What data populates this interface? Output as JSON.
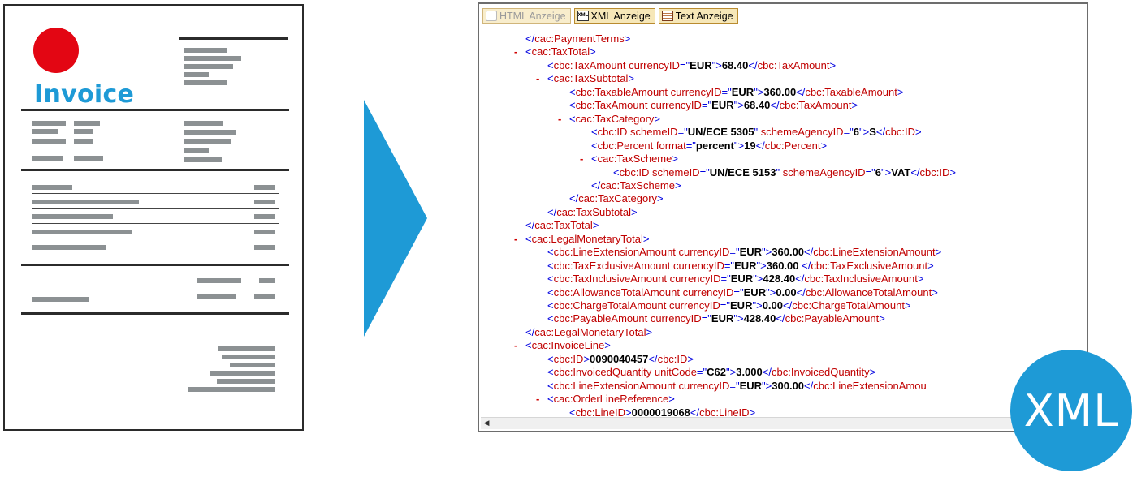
{
  "invoice": {
    "title": "Invoice"
  },
  "toolbar": {
    "html_label": "HTML Anzeige",
    "xml_label": "XML Anzeige",
    "text_label": "Text Anzeige",
    "xml_icon_text": "XML"
  },
  "xml_lines": [
    {
      "indent": 2,
      "marker": "",
      "parts": [
        [
          "b",
          "</"
        ],
        [
          "r",
          "cac:PaymentTerms"
        ],
        [
          "b",
          ">"
        ]
      ]
    },
    {
      "indent": 2,
      "marker": "-",
      "parts": [
        [
          "b",
          "<"
        ],
        [
          "r",
          "cac:TaxTotal"
        ],
        [
          "b",
          ">"
        ]
      ]
    },
    {
      "indent": 3,
      "marker": "",
      "parts": [
        [
          "b",
          "<"
        ],
        [
          "r",
          "cbc:TaxAmount currencyID"
        ],
        [
          "b",
          "=\""
        ],
        [
          "k",
          "EUR"
        ],
        [
          "b",
          "\">"
        ],
        [
          "k",
          "68.40"
        ],
        [
          "b",
          "</"
        ],
        [
          "r",
          "cbc:TaxAmount"
        ],
        [
          "b",
          ">"
        ]
      ]
    },
    {
      "indent": 3,
      "marker": "-",
      "parts": [
        [
          "b",
          "<"
        ],
        [
          "r",
          "cac:TaxSubtotal"
        ],
        [
          "b",
          ">"
        ]
      ]
    },
    {
      "indent": 4,
      "marker": "",
      "parts": [
        [
          "b",
          "<"
        ],
        [
          "r",
          "cbc:TaxableAmount currencyID"
        ],
        [
          "b",
          "=\""
        ],
        [
          "k",
          "EUR"
        ],
        [
          "b",
          "\">"
        ],
        [
          "k",
          "360.00"
        ],
        [
          "b",
          "</"
        ],
        [
          "r",
          "cbc:TaxableAmount"
        ],
        [
          "b",
          ">"
        ]
      ]
    },
    {
      "indent": 4,
      "marker": "",
      "parts": [
        [
          "b",
          "<"
        ],
        [
          "r",
          "cbc:TaxAmount currencyID"
        ],
        [
          "b",
          "=\""
        ],
        [
          "k",
          "EUR"
        ],
        [
          "b",
          "\">"
        ],
        [
          "k",
          "68.40"
        ],
        [
          "b",
          "</"
        ],
        [
          "r",
          "cbc:TaxAmount"
        ],
        [
          "b",
          ">"
        ]
      ]
    },
    {
      "indent": 4,
      "marker": "-",
      "parts": [
        [
          "b",
          "<"
        ],
        [
          "r",
          "cac:TaxCategory"
        ],
        [
          "b",
          ">"
        ]
      ]
    },
    {
      "indent": 5,
      "marker": "",
      "parts": [
        [
          "b",
          "<"
        ],
        [
          "r",
          "cbc:ID schemeID"
        ],
        [
          "b",
          "=\""
        ],
        [
          "k",
          "UN/ECE 5305"
        ],
        [
          "b",
          "\" "
        ],
        [
          "r",
          "schemeAgencyID"
        ],
        [
          "b",
          "=\""
        ],
        [
          "k",
          "6"
        ],
        [
          "b",
          "\">"
        ],
        [
          "k",
          "S"
        ],
        [
          "b",
          "</"
        ],
        [
          "r",
          "cbc:ID"
        ],
        [
          "b",
          ">"
        ]
      ]
    },
    {
      "indent": 5,
      "marker": "",
      "parts": [
        [
          "b",
          "<"
        ],
        [
          "r",
          "cbc:Percent format"
        ],
        [
          "b",
          "=\""
        ],
        [
          "k",
          "percent"
        ],
        [
          "b",
          "\">"
        ],
        [
          "k",
          "19"
        ],
        [
          "b",
          "</"
        ],
        [
          "r",
          "cbc:Percent"
        ],
        [
          "b",
          ">"
        ]
      ]
    },
    {
      "indent": 5,
      "marker": "-",
      "parts": [
        [
          "b",
          "<"
        ],
        [
          "r",
          "cac:TaxScheme"
        ],
        [
          "b",
          ">"
        ]
      ]
    },
    {
      "indent": 6,
      "marker": "",
      "parts": [
        [
          "b",
          "<"
        ],
        [
          "r",
          "cbc:ID schemeID"
        ],
        [
          "b",
          "=\""
        ],
        [
          "k",
          "UN/ECE 5153"
        ],
        [
          "b",
          "\" "
        ],
        [
          "r",
          "schemeAgencyID"
        ],
        [
          "b",
          "=\""
        ],
        [
          "k",
          "6"
        ],
        [
          "b",
          "\">"
        ],
        [
          "k",
          "VAT"
        ],
        [
          "b",
          "</"
        ],
        [
          "r",
          "cbc:ID"
        ],
        [
          "b",
          ">"
        ]
      ]
    },
    {
      "indent": 5,
      "marker": "",
      "parts": [
        [
          "b",
          "</"
        ],
        [
          "r",
          "cac:TaxScheme"
        ],
        [
          "b",
          ">"
        ]
      ]
    },
    {
      "indent": 4,
      "marker": "",
      "parts": [
        [
          "b",
          "</"
        ],
        [
          "r",
          "cac:TaxCategory"
        ],
        [
          "b",
          ">"
        ]
      ]
    },
    {
      "indent": 3,
      "marker": "",
      "parts": [
        [
          "b",
          "</"
        ],
        [
          "r",
          "cac:TaxSubtotal"
        ],
        [
          "b",
          ">"
        ]
      ]
    },
    {
      "indent": 2,
      "marker": "",
      "parts": [
        [
          "b",
          "</"
        ],
        [
          "r",
          "cac:TaxTotal"
        ],
        [
          "b",
          ">"
        ]
      ]
    },
    {
      "indent": 2,
      "marker": "-",
      "parts": [
        [
          "b",
          "<"
        ],
        [
          "r",
          "cac:LegalMonetaryTotal"
        ],
        [
          "b",
          ">"
        ]
      ]
    },
    {
      "indent": 3,
      "marker": "",
      "parts": [
        [
          "b",
          "<"
        ],
        [
          "r",
          "cbc:LineExtensionAmount currencyID"
        ],
        [
          "b",
          "=\""
        ],
        [
          "k",
          "EUR"
        ],
        [
          "b",
          "\">"
        ],
        [
          "k",
          "360.00"
        ],
        [
          "b",
          "</"
        ],
        [
          "r",
          "cbc:LineExtensionAmount"
        ],
        [
          "b",
          ">"
        ]
      ]
    },
    {
      "indent": 3,
      "marker": "",
      "parts": [
        [
          "b",
          "<"
        ],
        [
          "r",
          "cbc:TaxExclusiveAmount currencyID"
        ],
        [
          "b",
          "=\""
        ],
        [
          "k",
          "EUR"
        ],
        [
          "b",
          "\">"
        ],
        [
          "k",
          "360.00"
        ],
        [
          "b",
          " </"
        ],
        [
          "r",
          "cbc:TaxExclusiveAmount"
        ],
        [
          "b",
          ">"
        ]
      ]
    },
    {
      "indent": 3,
      "marker": "",
      "parts": [
        [
          "b",
          "<"
        ],
        [
          "r",
          "cbc:TaxInclusiveAmount currencyID"
        ],
        [
          "b",
          "=\""
        ],
        [
          "k",
          "EUR"
        ],
        [
          "b",
          "\">"
        ],
        [
          "k",
          "428.40"
        ],
        [
          "b",
          "</"
        ],
        [
          "r",
          "cbc:TaxInclusiveAmount"
        ],
        [
          "b",
          ">"
        ]
      ]
    },
    {
      "indent": 3,
      "marker": "",
      "parts": [
        [
          "b",
          "<"
        ],
        [
          "r",
          "cbc:AllowanceTotalAmount currencyID"
        ],
        [
          "b",
          "=\""
        ],
        [
          "k",
          "EUR"
        ],
        [
          "b",
          "\">"
        ],
        [
          "k",
          "0.00"
        ],
        [
          "b",
          "</"
        ],
        [
          "r",
          "cbc:AllowanceTotalAmount"
        ],
        [
          "b",
          ">"
        ]
      ]
    },
    {
      "indent": 3,
      "marker": "",
      "parts": [
        [
          "b",
          "<"
        ],
        [
          "r",
          "cbc:ChargeTotalAmount currencyID"
        ],
        [
          "b",
          "=\""
        ],
        [
          "k",
          "EUR"
        ],
        [
          "b",
          "\">"
        ],
        [
          "k",
          "0.00"
        ],
        [
          "b",
          "</"
        ],
        [
          "r",
          "cbc:ChargeTotalAmount"
        ],
        [
          "b",
          ">"
        ]
      ]
    },
    {
      "indent": 3,
      "marker": "",
      "parts": [
        [
          "b",
          "<"
        ],
        [
          "r",
          "cbc:PayableAmount currencyID"
        ],
        [
          "b",
          "=\""
        ],
        [
          "k",
          "EUR"
        ],
        [
          "b",
          "\">"
        ],
        [
          "k",
          "428.40"
        ],
        [
          "b",
          "</"
        ],
        [
          "r",
          "cbc:PayableAmount"
        ],
        [
          "b",
          ">"
        ]
      ]
    },
    {
      "indent": 2,
      "marker": "",
      "parts": [
        [
          "b",
          "</"
        ],
        [
          "r",
          "cac:LegalMonetaryTotal"
        ],
        [
          "b",
          ">"
        ]
      ]
    },
    {
      "indent": 2,
      "marker": "-",
      "parts": [
        [
          "b",
          "<"
        ],
        [
          "r",
          "cac:InvoiceLine"
        ],
        [
          "b",
          ">"
        ]
      ]
    },
    {
      "indent": 3,
      "marker": "",
      "parts": [
        [
          "b",
          "<"
        ],
        [
          "r",
          "cbc:ID"
        ],
        [
          "b",
          ">"
        ],
        [
          "k",
          "0090040457"
        ],
        [
          "b",
          "</"
        ],
        [
          "r",
          "cbc:ID"
        ],
        [
          "b",
          ">"
        ]
      ]
    },
    {
      "indent": 3,
      "marker": "",
      "parts": [
        [
          "b",
          "<"
        ],
        [
          "r",
          "cbc:InvoicedQuantity unitCode"
        ],
        [
          "b",
          "=\""
        ],
        [
          "k",
          "C62"
        ],
        [
          "b",
          "\">"
        ],
        [
          "k",
          "3.000"
        ],
        [
          "b",
          "</"
        ],
        [
          "r",
          "cbc:InvoicedQuantity"
        ],
        [
          "b",
          ">"
        ]
      ]
    },
    {
      "indent": 3,
      "marker": "",
      "parts": [
        [
          "b",
          "<"
        ],
        [
          "r",
          "cbc:LineExtensionAmount currencyID"
        ],
        [
          "b",
          "=\""
        ],
        [
          "k",
          "EUR"
        ],
        [
          "b",
          "\">"
        ],
        [
          "k",
          "300.00"
        ],
        [
          "b",
          "</"
        ],
        [
          "r",
          "cbc:LineExtensionAmou"
        ]
      ]
    },
    {
      "indent": 3,
      "marker": "-",
      "parts": [
        [
          "b",
          "<"
        ],
        [
          "r",
          "cac:OrderLineReference"
        ],
        [
          "b",
          ">"
        ]
      ]
    },
    {
      "indent": 4,
      "marker": "",
      "parts": [
        [
          "b",
          "<"
        ],
        [
          "r",
          "cbc:LineID"
        ],
        [
          "b",
          ">"
        ],
        [
          "k",
          "0000019068"
        ],
        [
          "b",
          "</"
        ],
        [
          "r",
          "cbc:LineID"
        ],
        [
          "b",
          ">"
        ]
      ]
    }
  ],
  "badge": {
    "label": "XML"
  },
  "colors": {
    "brand_blue": "#1e9ad6",
    "dot_red": "#e30613",
    "tag_red": "#c00000",
    "bracket_blue": "#0000e0"
  }
}
